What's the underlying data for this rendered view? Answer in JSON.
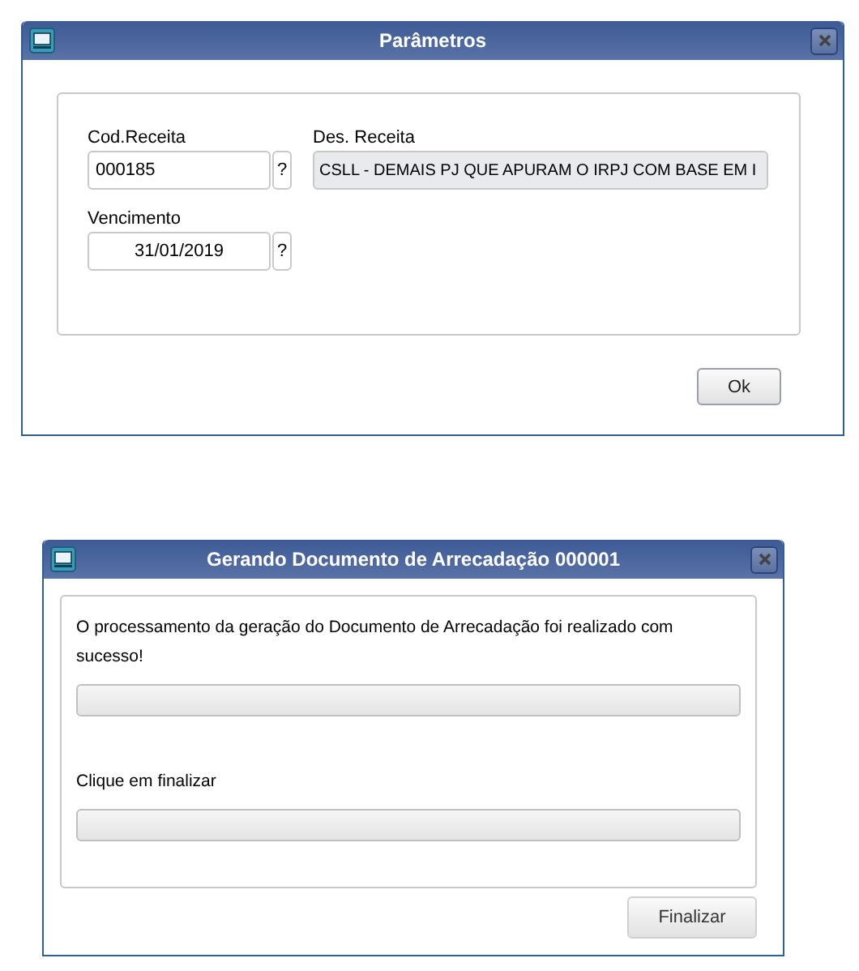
{
  "dialogs": [
    {
      "kind": "form",
      "title": "Parâmetros",
      "fields": [
        {
          "kind": "text",
          "label": "Cod.Receita",
          "value": "000185",
          "lookup": "?",
          "readonly": false
        },
        {
          "kind": "text",
          "label": "Des. Receita",
          "value": "CSLL - DEMAIS PJ QUE APURAM O IRPJ COM BASE EM I",
          "readonly": true
        },
        {
          "kind": "date",
          "label": "Vencimento",
          "value": "31/01/2019",
          "lookup": "?",
          "readonly": false
        }
      ],
      "button": "Ok"
    },
    {
      "kind": "progress",
      "title": "Gerando Documento de Arrecadação 000001",
      "steps": [
        {
          "message": "O processamento da geração do Documento de Arrecadação foi realizado com sucesso!",
          "level": 0
        },
        {
          "message": "Clique em finalizar",
          "level": 0
        }
      ],
      "button": "Finalizar"
    }
  ]
}
